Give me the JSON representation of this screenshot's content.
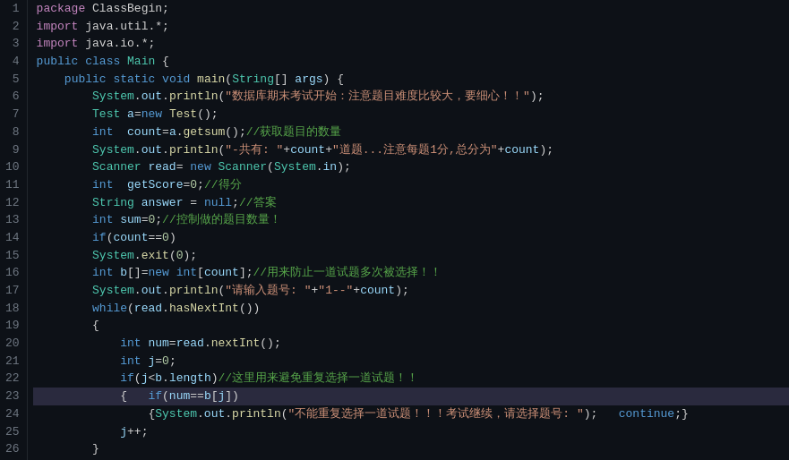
{
  "editor": {
    "lines": [
      {
        "num": 1,
        "highlighted": false
      },
      {
        "num": 2,
        "highlighted": false
      },
      {
        "num": 3,
        "highlighted": false
      },
      {
        "num": 4,
        "highlighted": false
      },
      {
        "num": 5,
        "highlighted": false
      },
      {
        "num": 6,
        "highlighted": false
      },
      {
        "num": 7,
        "highlighted": false
      },
      {
        "num": 8,
        "highlighted": false
      },
      {
        "num": 9,
        "highlighted": false
      },
      {
        "num": 10,
        "highlighted": false
      },
      {
        "num": 11,
        "highlighted": false
      },
      {
        "num": 12,
        "highlighted": false
      },
      {
        "num": 13,
        "highlighted": false
      },
      {
        "num": 14,
        "highlighted": false
      },
      {
        "num": 15,
        "highlighted": false
      },
      {
        "num": 16,
        "highlighted": false
      },
      {
        "num": 17,
        "highlighted": false
      },
      {
        "num": 18,
        "highlighted": false
      },
      {
        "num": 19,
        "highlighted": false
      },
      {
        "num": 20,
        "highlighted": false
      },
      {
        "num": 21,
        "highlighted": false
      },
      {
        "num": 22,
        "highlighted": false
      },
      {
        "num": 23,
        "highlighted": true
      },
      {
        "num": 24,
        "highlighted": false
      },
      {
        "num": 25,
        "highlighted": false
      },
      {
        "num": 26,
        "highlighted": false
      }
    ]
  }
}
